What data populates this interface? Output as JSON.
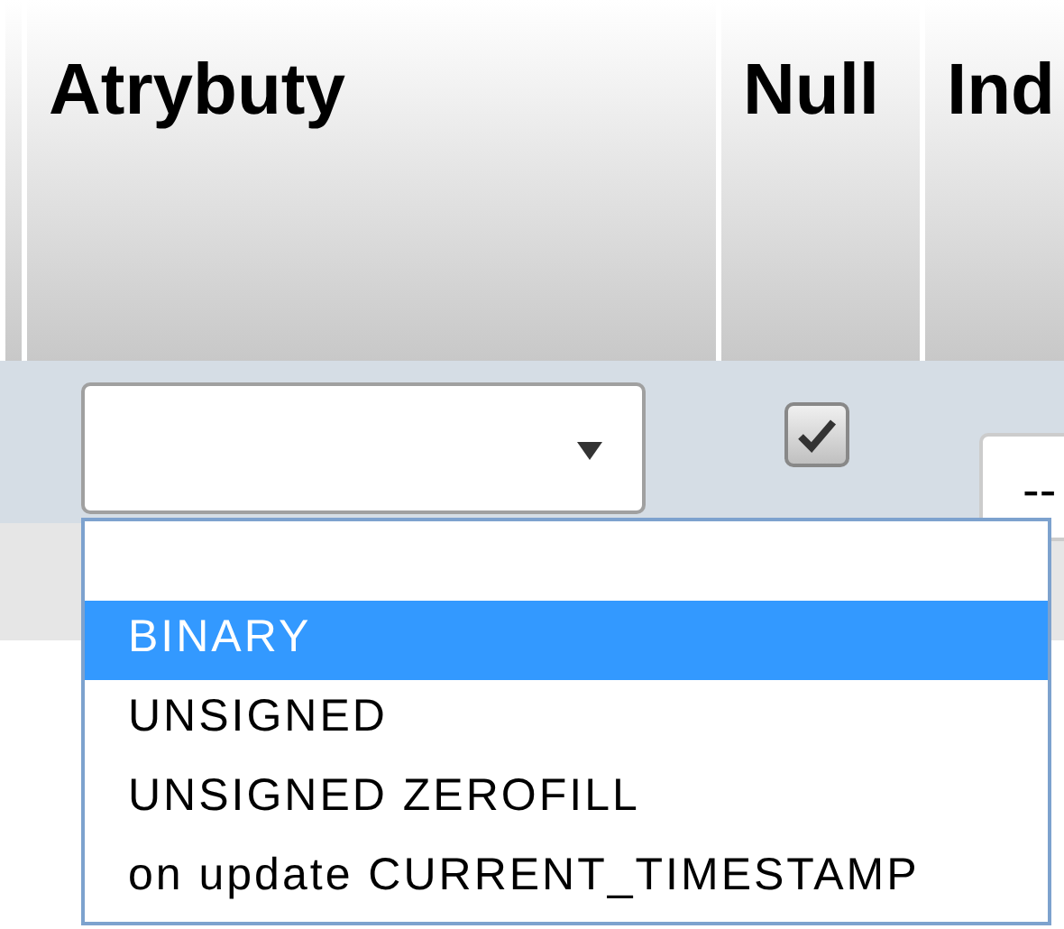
{
  "table": {
    "columns": [
      {
        "label": "Atrybuty"
      },
      {
        "label": "Null"
      },
      {
        "label": "Ind"
      }
    ],
    "row": {
      "null_checked": true,
      "index_value": "--"
    }
  },
  "dropdown": {
    "options": [
      {
        "kind": "blank",
        "selected": false
      },
      {
        "kind": "option",
        "label": "BINARY",
        "selected": true
      },
      {
        "kind": "option",
        "label": "UNSIGNED",
        "selected": false
      },
      {
        "kind": "option",
        "label": "UNSIGNED ZEROFILL",
        "selected": false
      },
      {
        "kind": "option",
        "label": "on update CURRENT_TIMESTAMP",
        "selected": false
      }
    ]
  }
}
